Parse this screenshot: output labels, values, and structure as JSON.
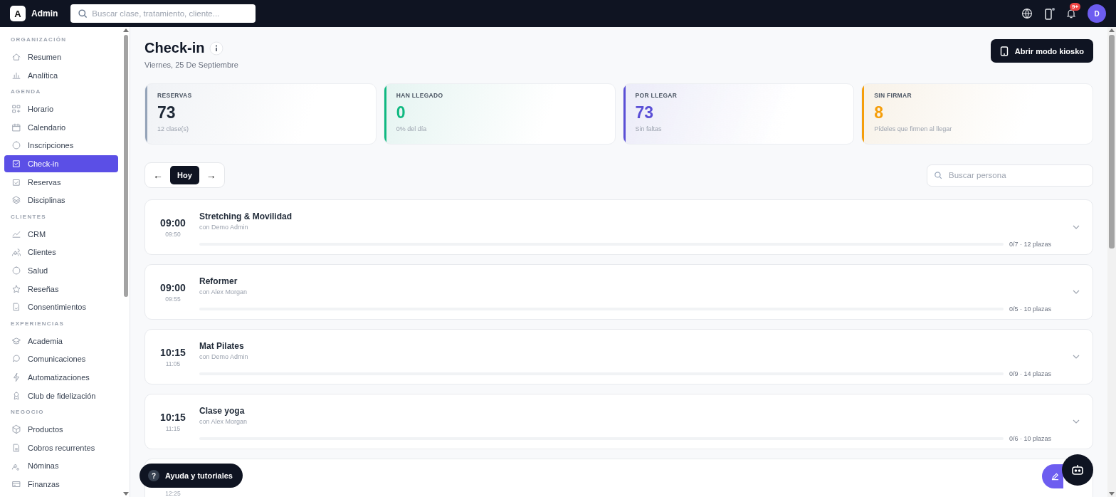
{
  "topbar": {
    "logo_letter": "A",
    "brand": "Admin",
    "search": {
      "placeholder": "Buscar clase, tratamiento, cliente..."
    },
    "notification_badge": "9+",
    "avatar": "D"
  },
  "sidebar": {
    "sections": [
      {
        "title": "ORGANIZACIÓN",
        "items": [
          {
            "label": "Resumen",
            "selected": false
          },
          {
            "label": "Analítica",
            "selected": false
          }
        ]
      },
      {
        "title": "AGENDA",
        "items": [
          {
            "label": "Horario",
            "selected": false
          },
          {
            "label": "Calendario",
            "selected": false
          },
          {
            "label": "Inscripciones",
            "selected": false
          },
          {
            "label": "Check-in",
            "selected": true
          },
          {
            "label": "Reservas",
            "selected": false
          },
          {
            "label": "Disciplinas",
            "selected": false
          }
        ]
      },
      {
        "title": "CLIENTES",
        "items": [
          {
            "label": "CRM",
            "selected": false
          },
          {
            "label": "Clientes",
            "selected": false
          },
          {
            "label": "Salud",
            "selected": false
          },
          {
            "label": "Reseñas",
            "selected": false
          },
          {
            "label": "Consentimientos",
            "selected": false
          }
        ]
      },
      {
        "title": "EXPERIENCIAS",
        "items": [
          {
            "label": "Academia",
            "selected": false
          },
          {
            "label": "Comunicaciones",
            "selected": false
          },
          {
            "label": "Automatizaciones",
            "selected": false
          },
          {
            "label": "Club de fidelización",
            "selected": false
          }
        ]
      },
      {
        "title": "NEGOCIO",
        "items": [
          {
            "label": "Productos",
            "selected": false
          },
          {
            "label": "Cobros recurrentes",
            "selected": false
          },
          {
            "label": "Nóminas",
            "selected": false
          },
          {
            "label": "Finanzas",
            "selected": false
          }
        ]
      }
    ]
  },
  "header": {
    "title": "Check-in",
    "date": "Viernes, 25 De Septiembre",
    "kiosk_button": "Abrir modo kiosko"
  },
  "stats": [
    {
      "label": "RESERVAS",
      "value": "73",
      "note": "12 clase(s)",
      "color": "#94a3b8"
    },
    {
      "label": "HAN LLEGADO",
      "value": "0",
      "note": "0% del día",
      "color": "#10b981"
    },
    {
      "label": "POR LLEGAR",
      "value": "73",
      "note": "Sin faltas",
      "color": "#5b4fd6"
    },
    {
      "label": "SIN FIRMAR",
      "value": "8",
      "note": "Pídeles que firmen al llegar",
      "color": "#f59e0b"
    }
  ],
  "day_nav": {
    "prev": "←",
    "today": "Hoy",
    "next": "→"
  },
  "person_search": {
    "placeholder": "Buscar persona"
  },
  "classes": [
    {
      "start": "09:00",
      "end": "09:50",
      "name": "Stretching & Movilidad",
      "teacher": "con Demo Admin",
      "capacity": "0/7 · 12 plazas"
    },
    {
      "start": "09:00",
      "end": "09:55",
      "name": "Reformer",
      "teacher": "con Alex Morgan",
      "capacity": "0/5 · 10 plazas"
    },
    {
      "start": "10:15",
      "end": "11:05",
      "name": "Mat Pilates",
      "teacher": "con Demo Admin",
      "capacity": "0/9 · 14 plazas"
    },
    {
      "start": "10:15",
      "end": "11:15",
      "name": "Clase yoga",
      "teacher": "con Alex Morgan",
      "capacity": "0/6 · 10 plazas"
    },
    {
      "end": "12:25"
    }
  ],
  "help_button": {
    "mark": "?",
    "label": "Ayuda y tutoriales"
  }
}
